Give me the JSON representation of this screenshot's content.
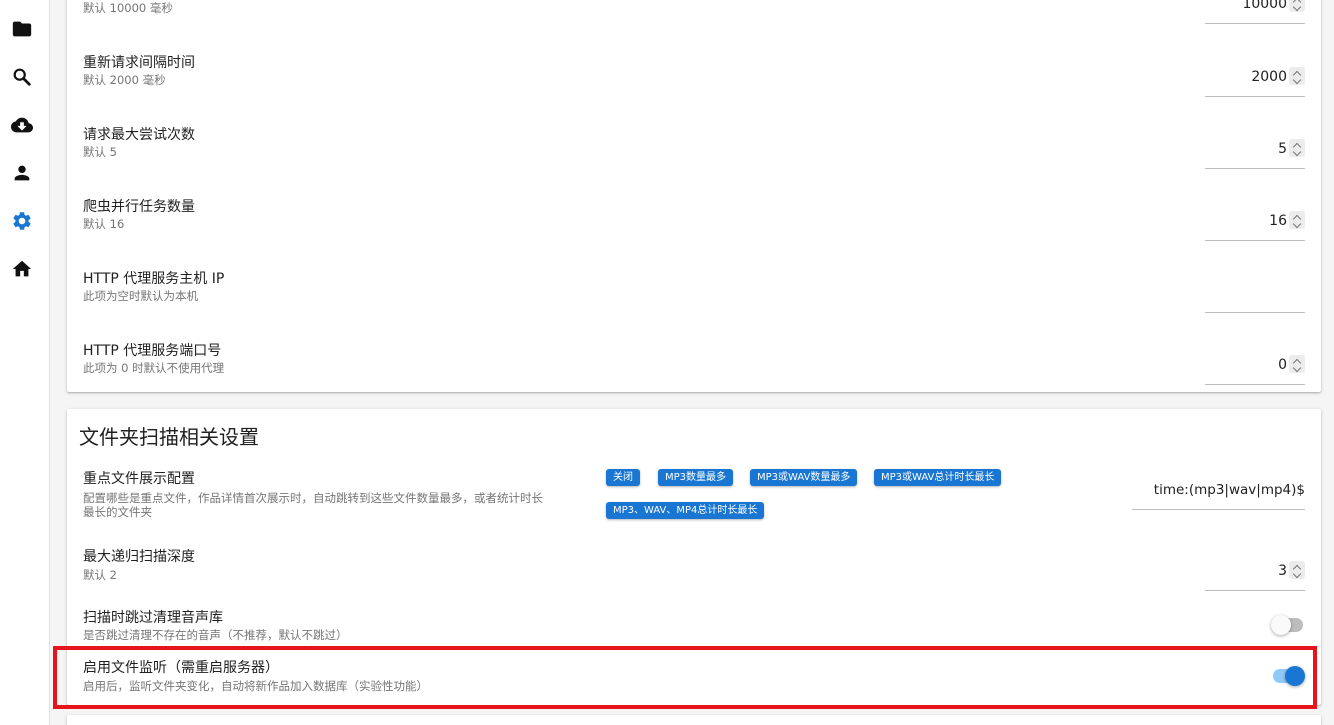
{
  "sidebar": {
    "items": [
      {
        "icon": "folder-icon",
        "name": "nav-folder"
      },
      {
        "icon": "search-icon",
        "name": "nav-search"
      },
      {
        "icon": "cloud-download-icon",
        "name": "nav-download"
      },
      {
        "icon": "person-icon",
        "name": "nav-user"
      },
      {
        "icon": "gear-icon",
        "name": "nav-settings",
        "active": true
      },
      {
        "icon": "home-icon",
        "name": "nav-home"
      }
    ],
    "active_color": "#1976d2"
  },
  "crawler": {
    "rows": [
      {
        "title": "",
        "subtitle": "默认 10000 毫秒",
        "value": "10000"
      },
      {
        "title": "重新请求间隔时间",
        "subtitle": "默认 2000 毫秒",
        "value": "2000"
      },
      {
        "title": "请求最大尝试次数",
        "subtitle": "默认 5",
        "value": "5"
      },
      {
        "title": "爬虫并行任务数量",
        "subtitle": "默认 16",
        "value": "16"
      },
      {
        "title": "HTTP 代理服务主机 IP",
        "subtitle": "此项为空时默认为本机",
        "value": ""
      },
      {
        "title": "HTTP 代理服务端口号",
        "subtitle": "此项为 0 时默认不使用代理",
        "value": "0"
      }
    ]
  },
  "scan": {
    "section_title": "文件夹扫描相关设置",
    "focus": {
      "title": "重点文件展示配置",
      "subtitle_line1": "配置哪些是重点文件，作品详情首次展示时，自动跳转到这些文件数量最多，或者统计时长",
      "subtitle_line2": "最长的文件夹",
      "chips": [
        "关闭",
        "MP3数量最多",
        "MP3或WAV数量最多",
        "MP3或WAV总计时长最长",
        "MP3、WAV、MP4总计时长最长"
      ],
      "value": "time:(mp3|wav|mp4)$"
    },
    "depth": {
      "title": "最大递归扫描深度",
      "subtitle": "默认 2",
      "value": "3"
    },
    "skip_clean": {
      "title": "扫描时跳过清理音声库",
      "subtitle": "是否跳过清理不存在的音声（不推荐，默认不跳过）",
      "enabled": false
    },
    "watch": {
      "title": "启用文件监听（需重启服务器）",
      "subtitle": "启用后，监听文件夹变化，自动将新作品加入数据库（实验性功能）",
      "enabled": true
    }
  },
  "colors": {
    "accent": "#1976d2",
    "highlight": "#e8141c"
  }
}
